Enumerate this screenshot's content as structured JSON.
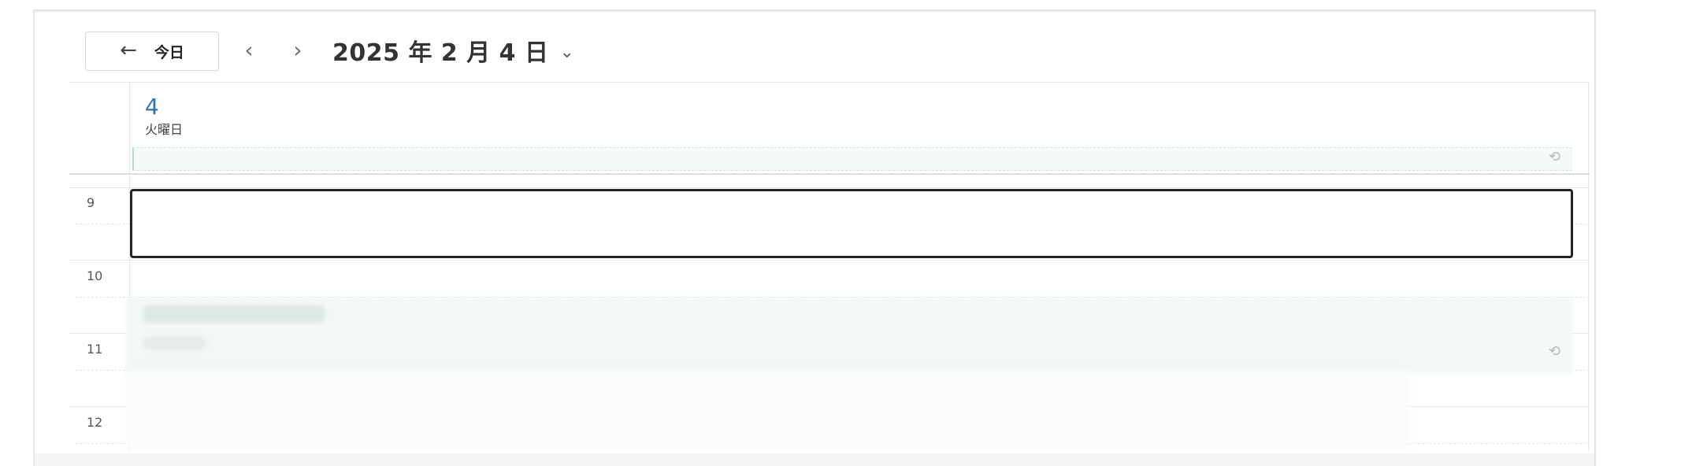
{
  "toolbar": {
    "back_arrow": "←",
    "today_label": "今日",
    "prev_glyph": "‹",
    "next_glyph": "›",
    "date_title": "2025 年 2 月 4 日",
    "date_chevron": "⌄"
  },
  "day_header": {
    "day_number": "4",
    "weekday": "火曜日"
  },
  "time_grid": {
    "hours": [
      "9",
      "10",
      "11",
      "12"
    ]
  },
  "icons": {
    "repeat": "⟲"
  },
  "colors": {
    "accent": "#2f72b8",
    "event_fill": "#f1f8f5",
    "selection_border": "#242424"
  }
}
